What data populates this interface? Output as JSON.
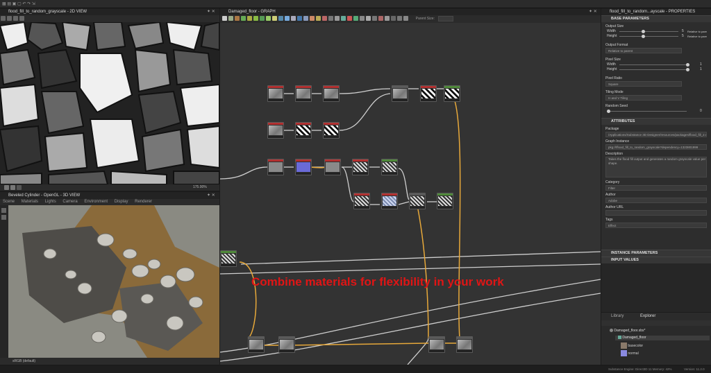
{
  "colors": {
    "accent": "#e8a93a",
    "overlay_text": "#e01515",
    "node_red": "#b23030",
    "node_green": "#4f8a3a",
    "node_gray": "#5a5a5a"
  },
  "view2d": {
    "title": "flood_fill_to_random_grayscale - 2D VIEW",
    "zoom": "175.00%"
  },
  "view3d": {
    "title": "Beveled Cylinder - OpenGL - 3D VIEW",
    "menu": [
      "Scene",
      "Materials",
      "Lights",
      "Camera",
      "Environment",
      "Display",
      "Renderer"
    ],
    "status": "sRGB (default)"
  },
  "graph": {
    "title": "Damaged_floor - GRAPH",
    "parent_size_label": "Parent Size:"
  },
  "overlay": {
    "caption": "Combine materials for flexibility in your work"
  },
  "properties": {
    "title": "flood_fill_to_random...ayscale - PROPERTIES",
    "base_params": "BASE PARAMETERS",
    "output_size": {
      "label": "Output Size",
      "width": "Width",
      "height": "Height",
      "val_w": "5",
      "val_h": "5",
      "rel_w": "Relative to parent",
      "rel_h": "Relative to parent"
    },
    "output_format": {
      "label": "Output Format",
      "value": "Relative to parent"
    },
    "pixel_size": {
      "label": "Pixel Size",
      "width": "Width",
      "height": "Height",
      "val_w": "1",
      "val_h": "1"
    },
    "pixel_ratio": {
      "label": "Pixel Ratio",
      "value": "Square"
    },
    "tiling_mode": {
      "label": "Tiling Mode",
      "value": "H and V Tiling"
    },
    "random_seed": {
      "label": "Random Seed",
      "value": "0"
    },
    "attributes": "ATTRIBUTES",
    "package": {
      "label": "Package",
      "value": "/Applications/Substance 3D Designer/resources/packages/flood_fill_2.sbs"
    },
    "graph_instance": {
      "label": "Graph Instance",
      "value": "pkg:///flood_fill_to_random_grayscale?dependency=1323801999"
    },
    "description": {
      "label": "Description",
      "value": "Takes the flood fill output and generates a random grayscale value per shape."
    },
    "category": {
      "label": "Category",
      "value": "Filter"
    },
    "author": {
      "label": "Author",
      "value": "Adobe"
    },
    "author_url": {
      "label": "Author URL",
      "value": ""
    },
    "tags": {
      "label": "Tags",
      "value": "Effect"
    },
    "instance_params": "INSTANCE PARAMETERS",
    "input_values": "INPUT VALUES"
  },
  "explorer": {
    "tabs": [
      "Library",
      "Explorer"
    ],
    "package": "Damaged_floor.sbs*",
    "graph": "Damaged_floor",
    "outputs": [
      "basecolor",
      "normal"
    ]
  },
  "statusbar": {
    "text": "Substance Engine: Direct3D 11  Memory: 42%",
    "version": "Version: 11.2.0"
  }
}
